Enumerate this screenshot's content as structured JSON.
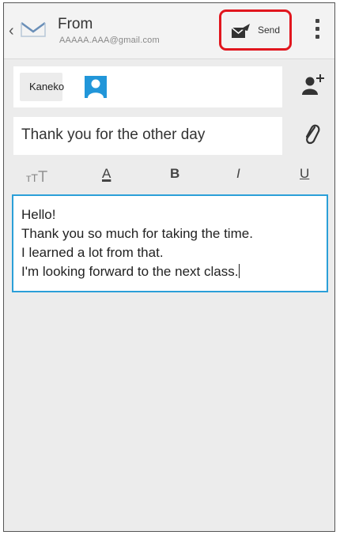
{
  "header": {
    "from_label": "From",
    "from_address": "AAAAA.AAA@gmail.com",
    "send_label": "Send"
  },
  "recipient": {
    "name": "Kaneko"
  },
  "subject": "Thank you for the other day",
  "format_bar": {
    "color_label": "A",
    "bold_label": "B",
    "italic_label": "I",
    "underline_label": "U"
  },
  "body": {
    "lines": [
      "Hello!",
      "Thank you so much for taking the time.",
      "I learned a lot from that.",
      "I'm looking forward to the next class."
    ]
  },
  "colors": {
    "accent": "#2b9fd8",
    "highlight": "#e1161e",
    "avatar": "#2196d9"
  }
}
